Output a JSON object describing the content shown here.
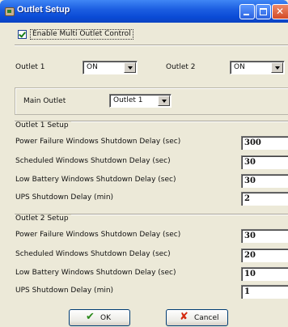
{
  "window": {
    "title": "Outlet Setup"
  },
  "multi_outlet": {
    "label": "Enable Multi Outlet Control",
    "checked": true
  },
  "outlets": [
    {
      "label": "Outlet 1",
      "value": "ON"
    },
    {
      "label": "Outlet 2",
      "value": "ON"
    }
  ],
  "main_outlet": {
    "label": "Main Outlet",
    "value": "Outlet 1"
  },
  "groups": [
    {
      "title": "Outlet 1 Setup",
      "rows": [
        {
          "label": "Power Failure Windows Shutdown Delay (sec)",
          "value": "300"
        },
        {
          "label": "Scheduled Windows Shutdown Delay (sec)",
          "value": "30"
        },
        {
          "label": "Low Battery Windows Shutdown Delay (sec)",
          "value": "30"
        },
        {
          "label": "UPS Shutdown Delay (min)",
          "value": "2"
        }
      ]
    },
    {
      "title": "Outlet 2 Setup",
      "rows": [
        {
          "label": "Power Failure Windows Shutdown Delay (sec)",
          "value": "30"
        },
        {
          "label": "Scheduled Windows Shutdown Delay (sec)",
          "value": "20"
        },
        {
          "label": "Low Battery Windows Shutdown Delay (sec)",
          "value": "10"
        },
        {
          "label": "UPS Shutdown Delay (min)",
          "value": "1"
        }
      ]
    }
  ],
  "buttons": {
    "ok": "OK",
    "cancel": "Cancel"
  },
  "icons": {
    "window": "app-icon",
    "ok": "check-icon",
    "cancel": "x-icon"
  }
}
